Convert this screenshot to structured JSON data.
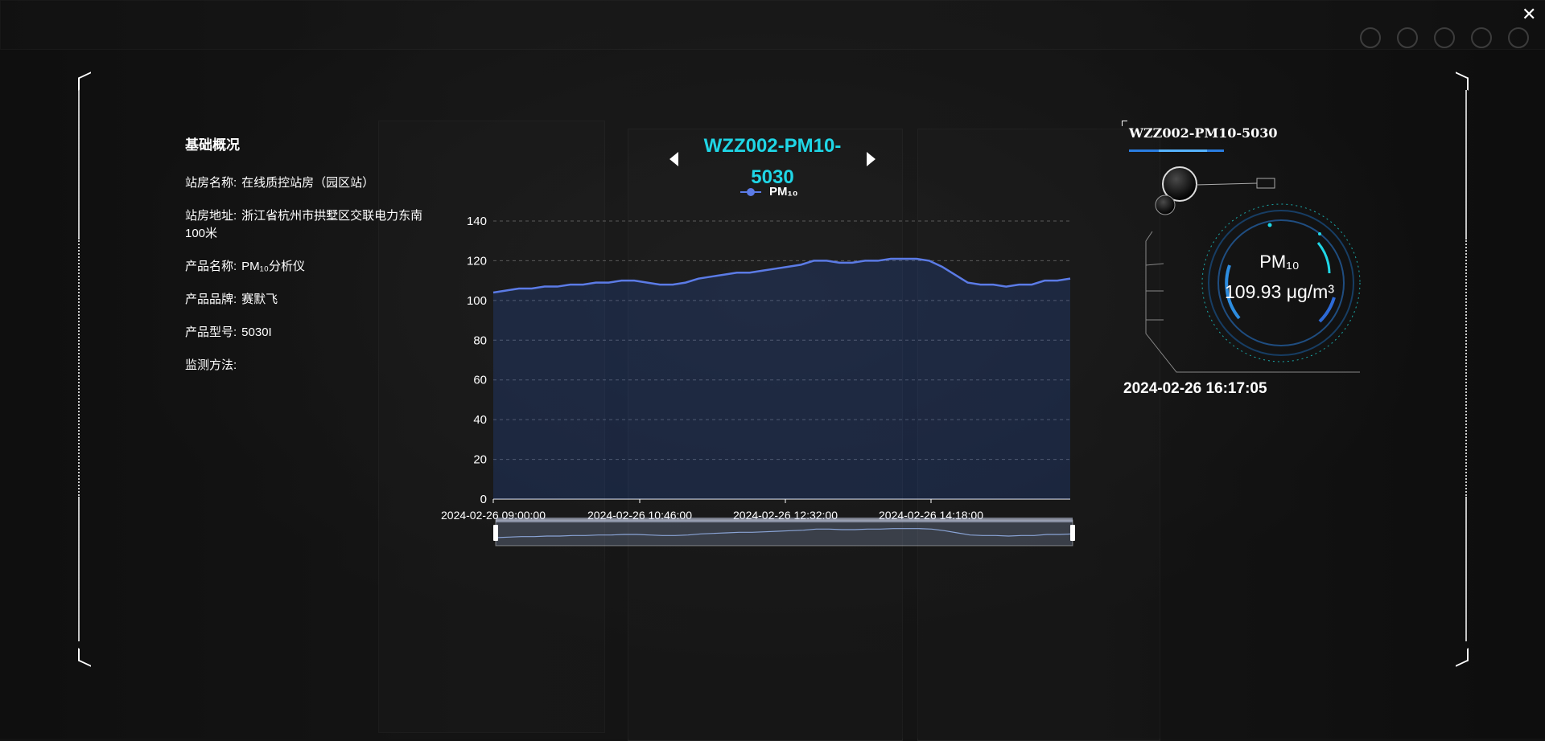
{
  "panel": {
    "title": "基础概况",
    "rows": [
      {
        "label": "站房名称:",
        "value": "在线质控站房（园区站）"
      },
      {
        "label": "站房地址:",
        "value": "浙江省杭州市拱墅区交联电力东南100米"
      },
      {
        "label": "产品名称:",
        "value": "PM₁₀分析仪"
      },
      {
        "label": "产品品牌:",
        "value": "赛默飞"
      },
      {
        "label": "产品型号:",
        "value": "5030I"
      },
      {
        "label": "监测方法:",
        "value": ""
      }
    ]
  },
  "chart_header": {
    "title": "WZZ002-PM10-5030",
    "legend": "PM₁₀"
  },
  "device": {
    "tab": "WZZ002-PM10-5030",
    "gauge_label": "PM₁₀",
    "gauge_value": "109.93 μg/m³",
    "timestamp": "2024-02-26 16:17:05"
  },
  "colors": {
    "accent": "#1fd6e6",
    "series": "#5b7be6",
    "tab_underline": "#2a7de1"
  },
  "icons": {
    "close": "close-icon",
    "prev": "caret-left-icon",
    "next": "caret-right-icon"
  },
  "chart_data": {
    "type": "area",
    "series": [
      {
        "name": "PM₁₀",
        "values": [
          104,
          105,
          106,
          106,
          107,
          107,
          108,
          108,
          109,
          109,
          110,
          110,
          109,
          108,
          108,
          109,
          111,
          112,
          113,
          114,
          114,
          115,
          116,
          117,
          118,
          120,
          120,
          119,
          119,
          120,
          120,
          121,
          121,
          121,
          120,
          117,
          113,
          109,
          108,
          108,
          107,
          108,
          108,
          110,
          110,
          111
        ]
      }
    ],
    "x_start": "2024-02-26 09:00:00",
    "x_end": "2024-02-26 16:17:05",
    "x_ticks": [
      "2024-02-26 09:00:00",
      "2024-02-26 10:46:00",
      "2024-02-26 12:32:00",
      "2024-02-26 14:18:00"
    ],
    "y_ticks": [
      0,
      20,
      40,
      60,
      80,
      100,
      120,
      140
    ],
    "ylim": [
      0,
      140
    ],
    "grid": true,
    "legend_position": "top-center",
    "data_zoom": true
  }
}
